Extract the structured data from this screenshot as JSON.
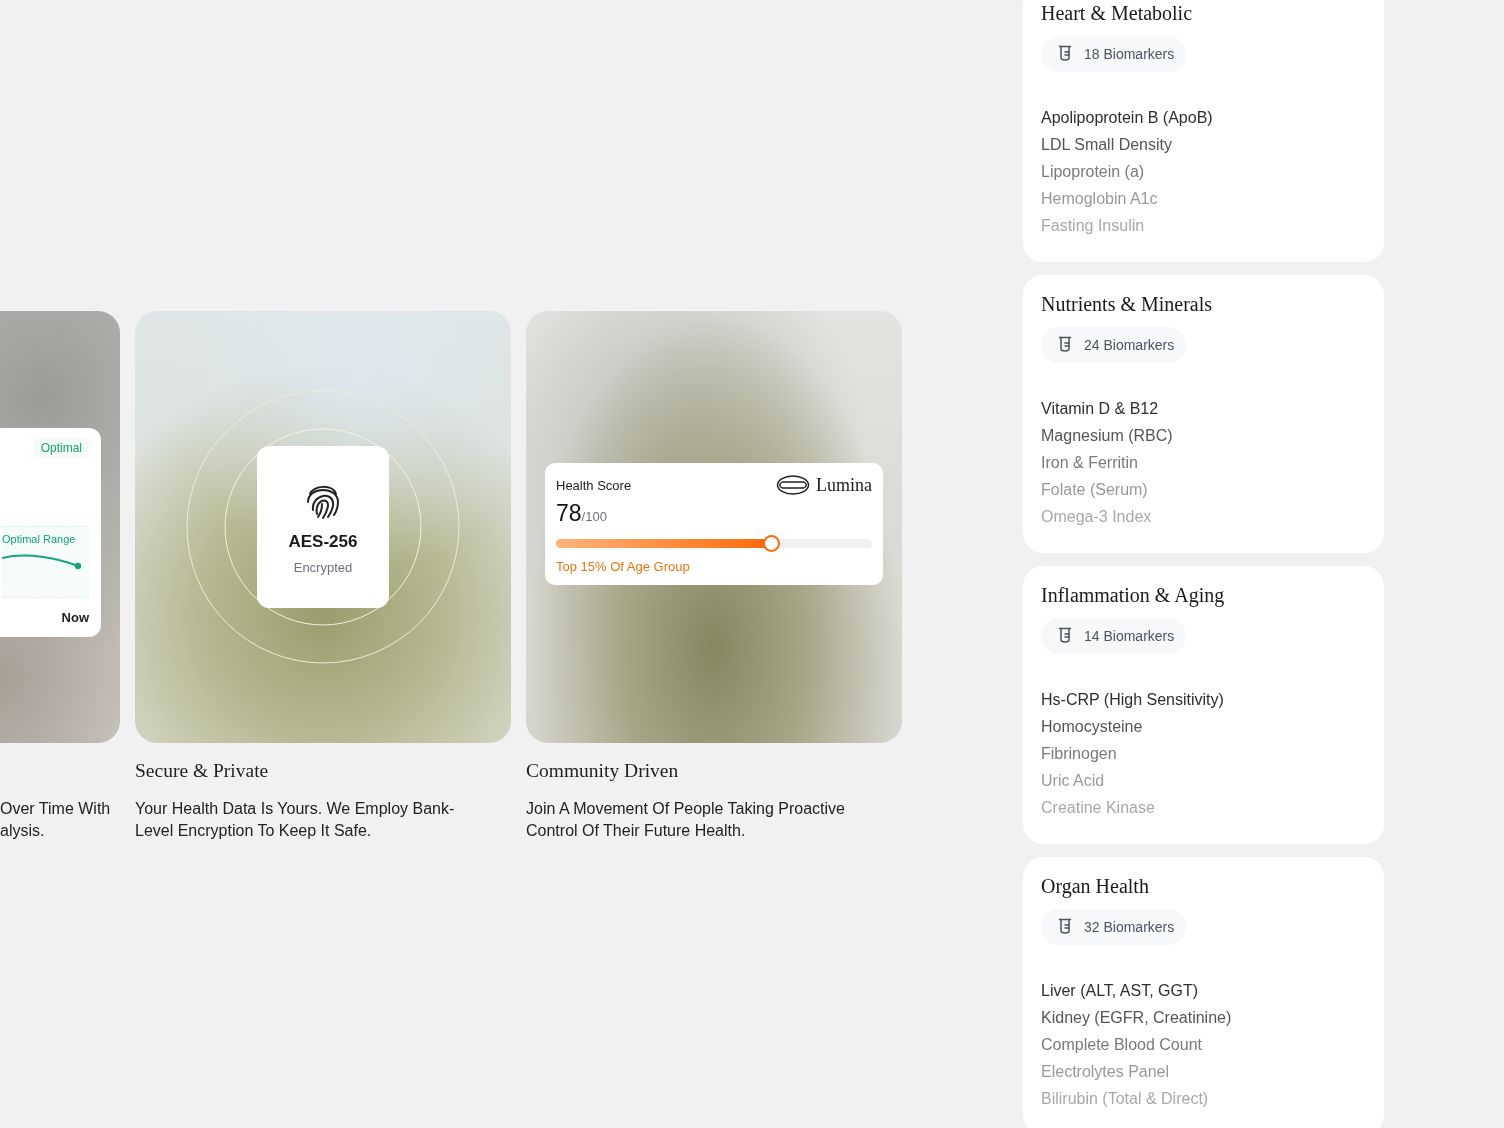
{
  "features": [
    {
      "kind": "trend",
      "badge": "Optimal",
      "range_label": "Optimal Range",
      "time_label": "Now",
      "description_lines": [
        "Over Time With",
        "alysis."
      ]
    },
    {
      "kind": "secure",
      "code": "AES-256",
      "caption": "Encrypted",
      "title": "Secure & Private",
      "description_lines": [
        "Your Health Data Is Yours. We Employ Bank-",
        "Level Encryption To Keep It Safe."
      ]
    },
    {
      "kind": "score",
      "label": "Health Score",
      "brand": "Lumina",
      "score": "78",
      "out_of": "/100",
      "level": 0.68,
      "note": "Top 15% Of Age Group",
      "title": "Community Driven",
      "description_lines": [
        "Join A Movement Of People Taking Proactive",
        "Control Of Their Future Health."
      ]
    }
  ],
  "panels": [
    {
      "title": "Heart & Metabolic",
      "count": "18 Biomarkers",
      "items": [
        "Apolipoprotein B (ApoB)",
        "LDL Small Density",
        "Lipoprotein (a)",
        "Hemoglobin A1c",
        "Fasting Insulin"
      ]
    },
    {
      "title": "Nutrients & Minerals",
      "count": "24 Biomarkers",
      "items": [
        "Vitamin D & B12",
        "Magnesium (RBC)",
        "Iron & Ferritin",
        "Folate (Serum)",
        "Omega-3 Index"
      ]
    },
    {
      "title": "Inflammation & Aging",
      "count": "14 Biomarkers",
      "items": [
        "Hs-CRP (High Sensitivity)",
        "Homocysteine",
        "Fibrinogen",
        "Uric Acid",
        "Creatine Kinase"
      ]
    },
    {
      "title": "Organ Health",
      "count": "32 Biomarkers",
      "items": [
        "Liver (ALT, AST, GGT)",
        "Kidney (EGFR, Creatinine)",
        "Complete Blood Count",
        "Electrolytes Panel",
        "Bilirubin (Total & Direct)"
      ]
    }
  ]
}
